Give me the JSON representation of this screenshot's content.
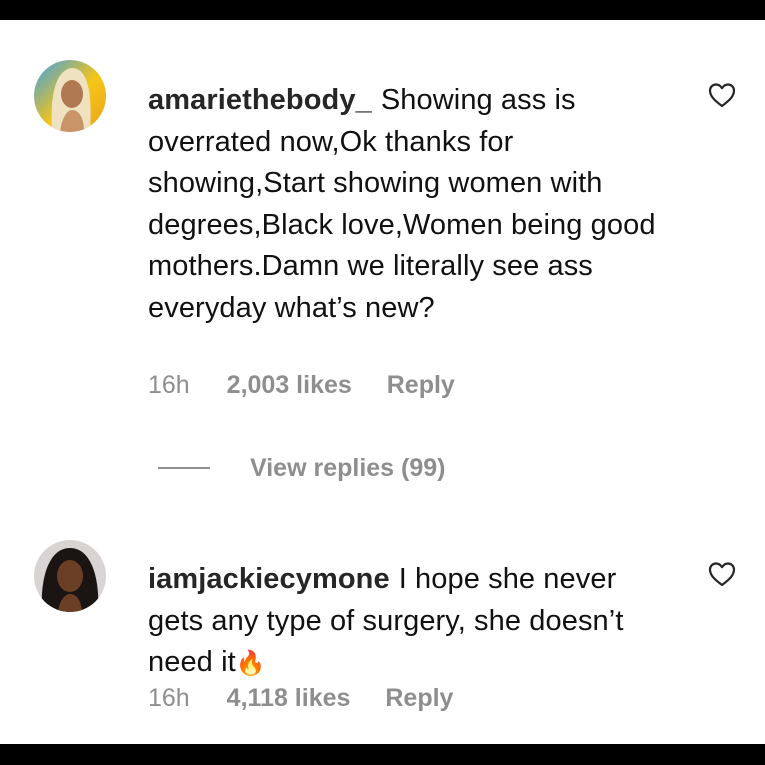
{
  "comments": [
    {
      "username": "amariethebody_",
      "text": "Showing ass is overrated now,Ok thanks for showing,Start showing women with degrees,Black love,Women being good mothers.Damn we literally see ass everyday what’s new?",
      "time": "16h",
      "likes": "2,003 likes",
      "reply": "Reply",
      "avatar_icon": "avatar-blonde-woman",
      "like_icon": "heart-outline-icon"
    },
    {
      "username": "iamjackiecymone",
      "text": "I hope she never gets any type of surgery, she doesn’t need it",
      "emoji": "🔥",
      "time": "16h",
      "likes": "4,118 likes",
      "reply": "Reply",
      "avatar_icon": "avatar-dark-hair-woman",
      "like_icon": "heart-outline-icon"
    }
  ],
  "view_replies": {
    "label": "View replies (99)"
  },
  "colors": {
    "text": "#111111",
    "meta": "#8e8e8e",
    "background": "#ffffff",
    "border": "#000000"
  }
}
